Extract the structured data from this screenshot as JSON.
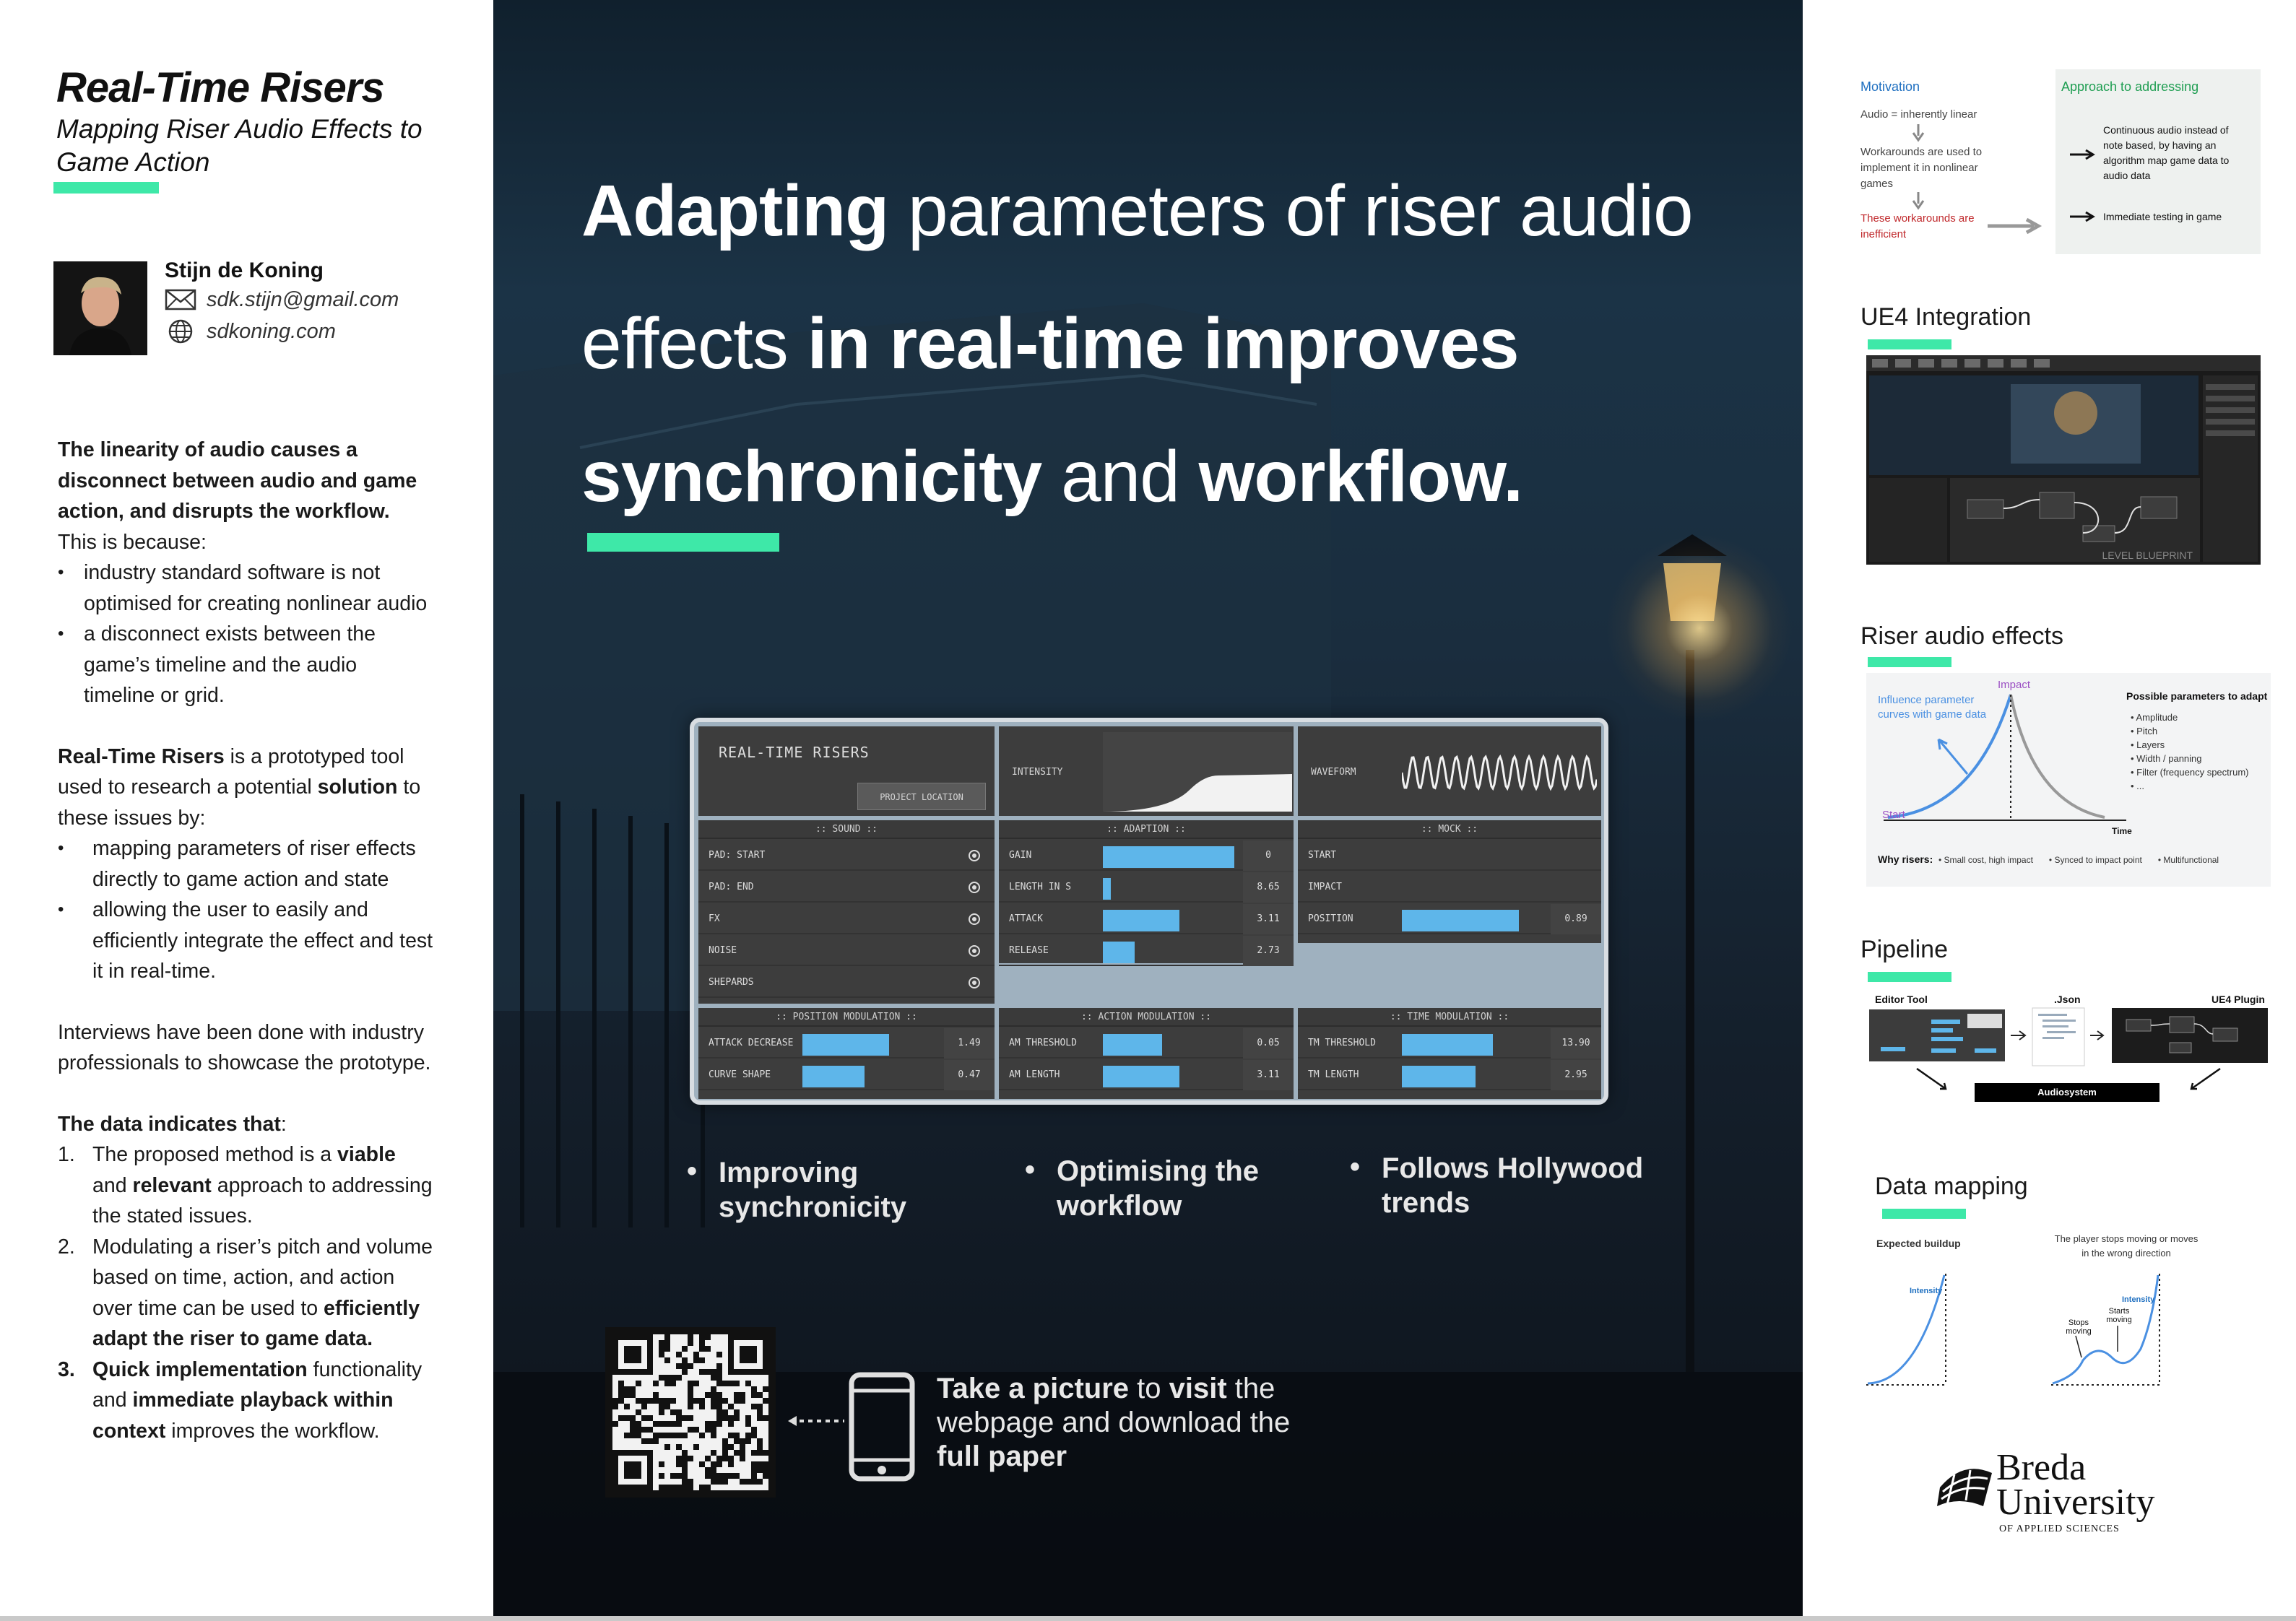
{
  "left": {
    "title": "Real-Time Risers",
    "subtitle": "Mapping Riser Audio Effects to Game Action",
    "author": "Stijn de Koning",
    "email": "sdk.stijn@gmail.com",
    "website": "sdkoning.com",
    "p1_bold": "The linearity of audio causes a disconnect between audio and game action, and disrupts the workflow.",
    "p1_rest": " This is because:",
    "p1_bullets": [
      "industry standard software is not optimised for creating nonlinear audio",
      "a disconnect exists between the game’s timeline and the audio timeline or grid."
    ],
    "p2_name": "Real-Time Risers",
    "p2_mid": " is a prototyped tool used to research a potential ",
    "p2_sol": "solution",
    "p2_end": " to these issues by:",
    "p2_bullets": [
      "mapping parameters of riser effects directly to game action and state",
      "allowing the user to easily and efficiently integrate the effect and test it in real-time."
    ],
    "p3": "Interviews have been done with industry professionals to showcase the prototype.",
    "p4_heading": "The data indicates that",
    "findings": [
      {
        "num": "1.",
        "a": "The proposed method is a ",
        "b": "viable",
        "c": " and ",
        "d": "relevant",
        "e": " approach to addressing the stated issues."
      },
      {
        "num": "2.",
        "a": "Modulating a riser’s pitch and volume based on time, action, and action over time can be used to ",
        "b": "efficiently adapt the riser to game data.",
        "c": "",
        "d": "",
        "e": ""
      },
      {
        "num": "3.",
        "a": "",
        "b": "Quick implementation",
        "c": " functionality and ",
        "d": "immediate playback within context",
        "e": " improves the workflow."
      }
    ]
  },
  "headline": {
    "w1": "Adapting",
    "w2": " parameters of riser audio effects ",
    "w3": "in ",
    "w4": "real-time",
    "w5": " improves ",
    "w6": "synchronicity",
    "w7": " and ",
    "w8": "workflow."
  },
  "mock": {
    "title": "REAL-TIME RISERS",
    "project_btn": "PROJECT LOCATION",
    "intensity": "INTENSITY",
    "waveform": "WAVEFORM",
    "sound_head": ":: SOUND ::",
    "sound_items": [
      "PAD: START",
      "PAD: END",
      "FX",
      "NOISE",
      "SHEPARDS"
    ],
    "adaption_head": ":: ADAPTION ::",
    "adaption": [
      {
        "label": "GAIN",
        "value": "0",
        "fill": 1.0
      },
      {
        "label": "LENGTH IN S",
        "value": "8.65",
        "fill": 0.06
      },
      {
        "label": "ATTACK",
        "value": "3.11",
        "fill": 0.58
      },
      {
        "label": "RELEASE",
        "value": "2.73",
        "fill": 0.24
      }
    ],
    "mock_head": ":: MOCK ::",
    "mock_items": [
      "START",
      "IMPACT",
      "POSITION"
    ],
    "position_value": "0.89",
    "position_fill": 0.89,
    "posmod_head": ":: POSITION MODULATION ::",
    "posmod": [
      {
        "label": "ATTACK DECREASE",
        "value": "1.49",
        "fill": 0.66
      },
      {
        "label": "CURVE SHAPE",
        "value": "0.47",
        "fill": 0.47
      }
    ],
    "actmod_head": ":: ACTION MODULATION ::",
    "actmod": [
      {
        "label": "AM THRESHOLD",
        "value": "0.05",
        "fill": 0.45
      },
      {
        "label": "AM LENGTH",
        "value": "3.11",
        "fill": 0.58
      }
    ],
    "timemod_head": ":: TIME MODULATION ::",
    "timemod": [
      {
        "label": "TM THRESHOLD",
        "value": "13.90",
        "fill": 0.69
      },
      {
        "label": "TM LENGTH",
        "value": "2.95",
        "fill": 0.56
      }
    ]
  },
  "bullets": [
    "Improving synchronicity",
    "Optimising the workflow",
    "Follows Hollywood trends"
  ],
  "cta": {
    "b1": "Take a picture",
    "t1": " to ",
    "b2": "visit",
    "t2": " the webpage and download the ",
    "b3": "full paper"
  },
  "right": {
    "motivation": {
      "title": "Motivation",
      "items": [
        "Audio = inherently linear",
        "Workarounds are used to implement it in nonlinear games",
        "These workarounds are inefficient"
      ]
    },
    "approach": {
      "title": "Approach to addressing",
      "items": [
        "Continuous audio instead of note based, by having an algorithm map game data to audio data",
        "Immediate testing in game"
      ]
    },
    "ue4": {
      "title": "UE4 Integration",
      "caption": "LEVEL BLUEPRINT"
    },
    "riser": {
      "title": "Riser audio effects",
      "influence": "Influence parameter curves with game data",
      "impact": "Impact",
      "start": "Start",
      "time": "Time",
      "params_title": "Possible parameters to adapt",
      "params": [
        "Amplitude",
        "Pitch",
        "Layers",
        "Width / panning",
        "Filter (frequency spectrum)",
        "..."
      ],
      "why": "Why risers:",
      "why_items": [
        "Small cost, high impact",
        "Synced to impact point",
        "Multifunctional"
      ]
    },
    "pipeline": {
      "title": "Pipeline",
      "editor": "Editor Tool",
      "json": ".Json",
      "plugin": "UE4 Plugin",
      "audiosystem": "Audiosystem"
    },
    "mapping": {
      "title": "Data mapping",
      "left_title": "Expected buildup",
      "right_title": "The player stops moving or moves in the wrong direction",
      "intensity": "Intensity",
      "stops": "Stops moving",
      "starts": "Starts moving"
    },
    "logo": {
      "line1": "Breda",
      "line2": "University",
      "line3": "OF APPLIED SCIENCES"
    }
  },
  "colors": {
    "accent": "#3ee8a8",
    "bar": "#5eb6ea",
    "dark_bg": "#15263a"
  }
}
